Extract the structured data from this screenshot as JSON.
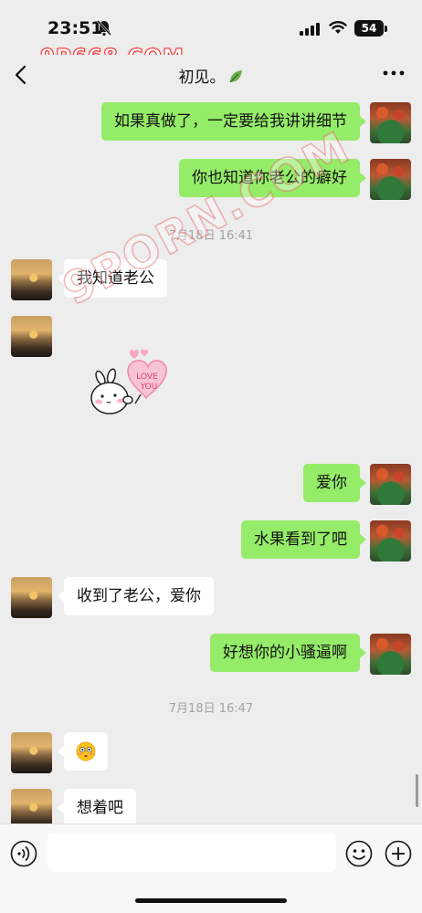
{
  "status_bar": {
    "time": "23:51",
    "battery": "54"
  },
  "watermark_top": "9P668.COM",
  "watermark_diag": "9PORN.COM",
  "header": {
    "title": "初见。"
  },
  "messages": [
    {
      "side": "right",
      "text": "如果真做了，一定要给我讲讲细节"
    },
    {
      "side": "right",
      "text": "你也知道你老公的癖好"
    },
    {
      "type": "time",
      "text": "7月18日 16:41"
    },
    {
      "side": "left",
      "text": "我知道老公"
    },
    {
      "side": "left",
      "type": "sticker",
      "sticker_text": "LOVE YOU"
    },
    {
      "side": "right",
      "text": "爱你"
    },
    {
      "side": "right",
      "text": "水果看到了吧"
    },
    {
      "side": "left",
      "text": "收到了老公，爱你"
    },
    {
      "side": "right",
      "text": "好想你的小骚逼啊"
    },
    {
      "type": "time",
      "text": "7月18日 16:47"
    },
    {
      "side": "left",
      "type": "emoji",
      "emoji": "flushed-face"
    },
    {
      "side": "left",
      "text": "想着吧"
    }
  ],
  "colors": {
    "bubble_right": "#95ec69",
    "bubble_left": "#ffffff",
    "background": "#ededed"
  }
}
